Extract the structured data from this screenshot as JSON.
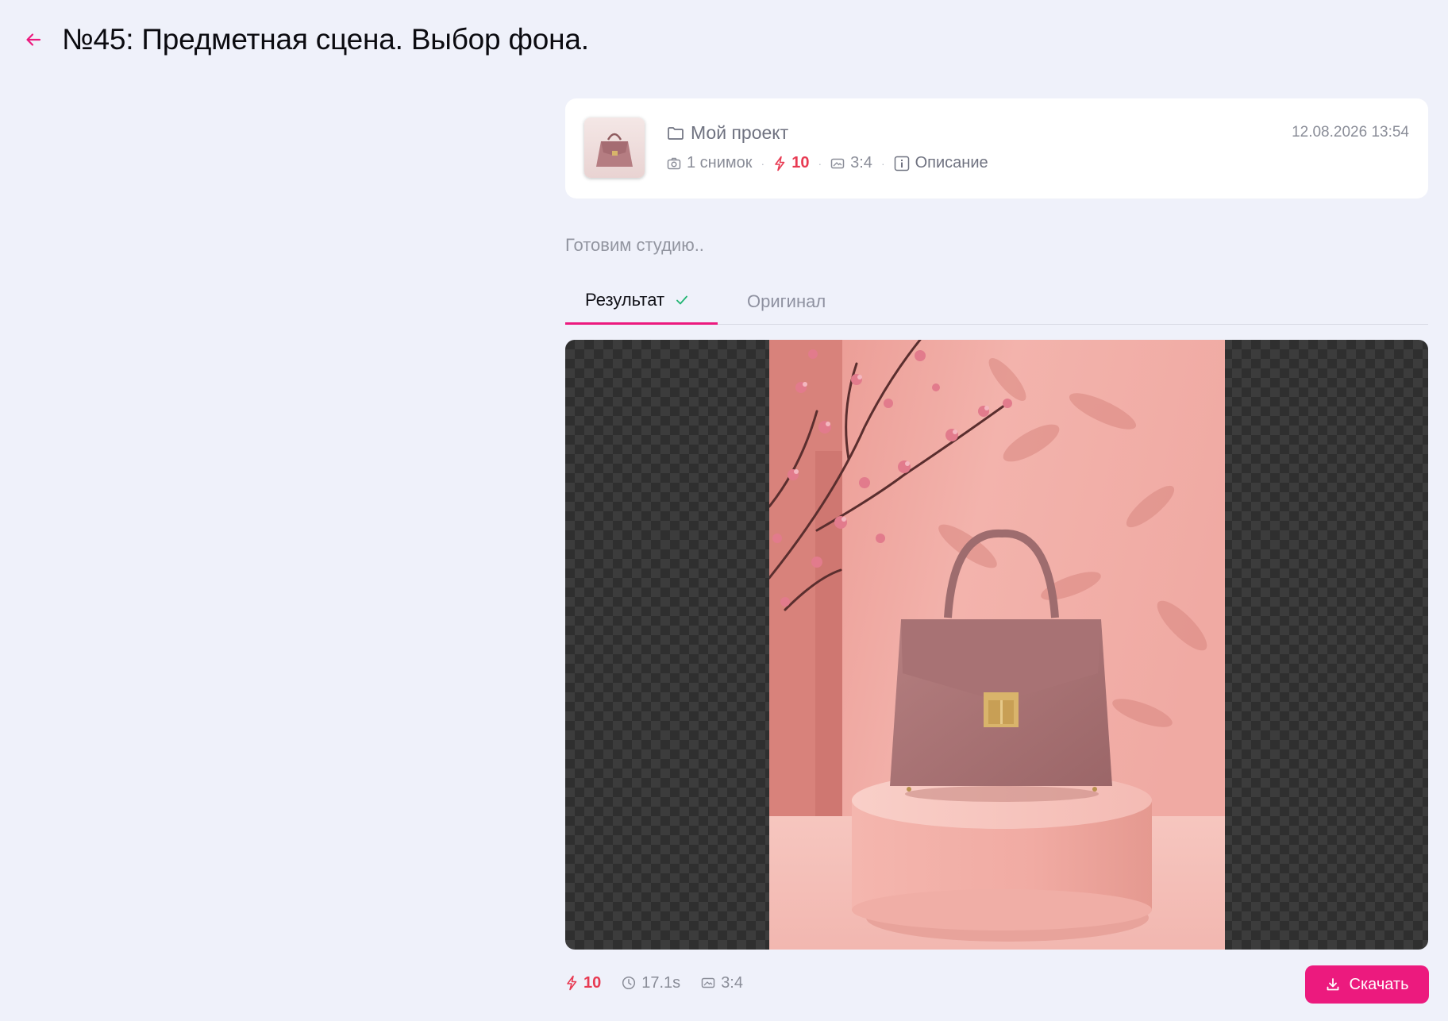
{
  "header": {
    "title": "№45: Предметная сцена. Выбор фона.",
    "back_icon": "arrow-left-icon"
  },
  "project_card": {
    "project_name": "Мой проект",
    "shots": "1 снимок",
    "credits": "10",
    "aspect": "3:4",
    "description_label": "Описание",
    "datetime": "12.08.2026 13:54"
  },
  "status": {
    "text": "Готовим студию.."
  },
  "tabs": [
    {
      "label": "Результат",
      "active": true,
      "done": true
    },
    {
      "label": "Оригинал",
      "active": false
    }
  ],
  "result": {
    "credits": "10",
    "duration": "17.1s",
    "aspect": "3:4"
  },
  "download": {
    "label": "Скачать"
  },
  "colors": {
    "accent": "#ec1a7e",
    "credits": "#e83a52",
    "background": "#eff1fa",
    "check": "#22b573"
  }
}
